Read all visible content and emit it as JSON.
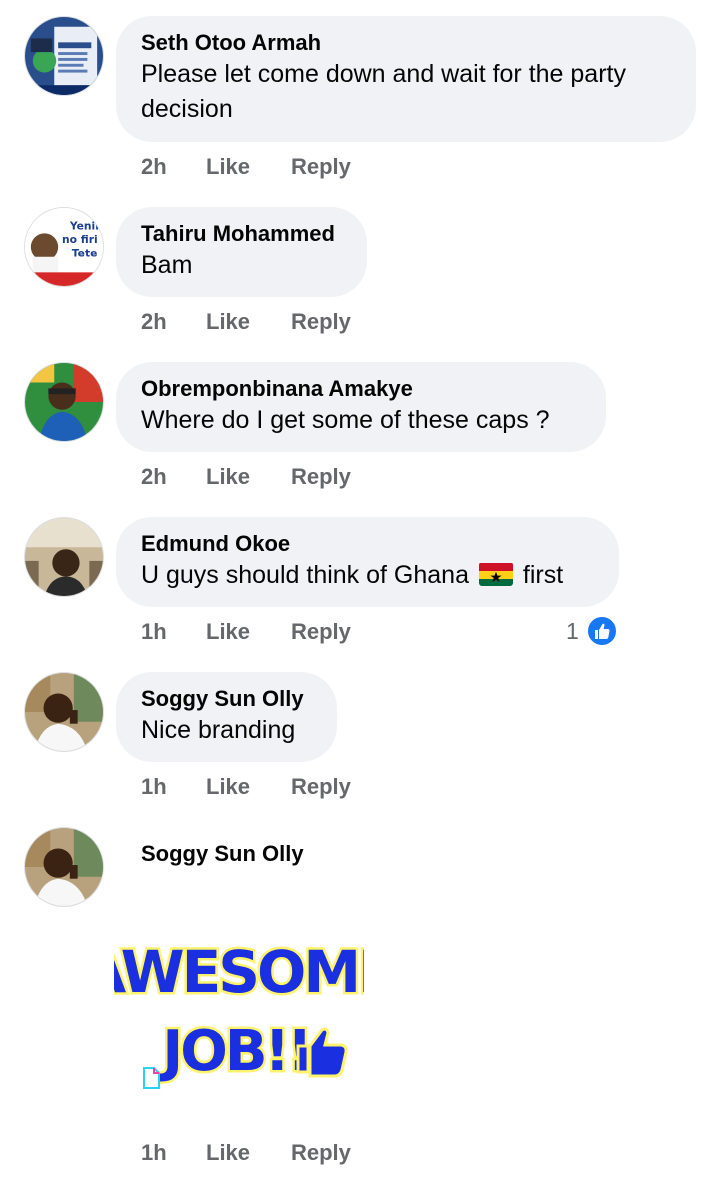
{
  "comments": [
    {
      "name": "Seth Otoo Armah",
      "text": "Please let come down and wait for the party decision",
      "time": "2h",
      "like": "Like",
      "reply": "Reply"
    },
    {
      "name": "Tahiru Mohammed",
      "text": "Bam",
      "time": "2h",
      "like": "Like",
      "reply": "Reply"
    },
    {
      "name": "Obremponbinana Amakye",
      "text": "Where do I get some of these caps ?",
      "time": "2h",
      "like": "Like",
      "reply": "Reply"
    },
    {
      "name": "Edmund Okoe",
      "text_before": "U guys should think of Ghana",
      "text_after": "first",
      "time": "1h",
      "like": "Like",
      "reply": "Reply",
      "reaction_count": "1"
    },
    {
      "name": "Soggy Sun Olly",
      "text": "Nice branding",
      "time": "1h",
      "like": "Like",
      "reply": "Reply"
    },
    {
      "name": "Soggy Sun Olly",
      "sticker_line1": "AWESOME",
      "sticker_line2": "JOB!!",
      "time": "1h",
      "like": "Like",
      "reply": "Reply"
    }
  ],
  "avatar_texts": {
    "tahiru": [
      "Yenim",
      "no firi",
      "Tete"
    ]
  },
  "colors": {
    "bubble": "#f0f2f5",
    "meta": "#65676b",
    "like_blue": "#1877f2",
    "sticker_blue": "#1a2fe0",
    "sticker_glow": "#fff36b"
  }
}
